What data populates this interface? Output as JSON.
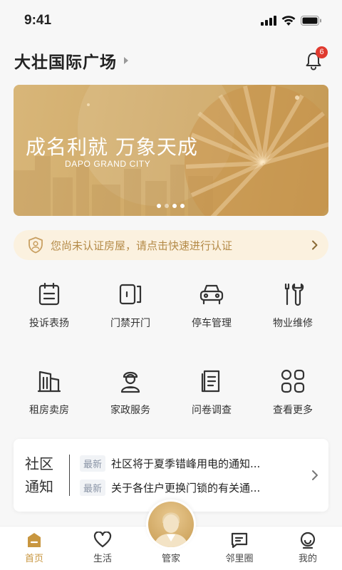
{
  "status": {
    "time": "9:41"
  },
  "header": {
    "community_name": "大壮国际广场",
    "notification_count": "6"
  },
  "banner": {
    "title": "成名利就 万象天成",
    "subtitle": "DAPO GRAND CITY",
    "slide_count": 4,
    "active_slide": 2
  },
  "notice": {
    "text": "您尚未认证房屋，请点击快速进行认证"
  },
  "services": [
    {
      "label": "投诉表扬",
      "icon": "clipboard-icon"
    },
    {
      "label": "门禁开门",
      "icon": "door-icon"
    },
    {
      "label": "停车管理",
      "icon": "car-icon"
    },
    {
      "label": "物业维修",
      "icon": "wrench-icon"
    },
    {
      "label": "租房卖房",
      "icon": "building-icon"
    },
    {
      "label": "家政服务",
      "icon": "housekeeper-icon"
    },
    {
      "label": "问卷调查",
      "icon": "questionnaire-icon"
    },
    {
      "label": "查看更多",
      "icon": "grid-more-icon"
    }
  ],
  "news": {
    "title_line1": "社区",
    "title_line2": "通知",
    "items": [
      {
        "tag": "最新",
        "text": "社区将于夏季错峰用电的通知..."
      },
      {
        "tag": "最新",
        "text": "关于各住户更换门锁的有关通..."
      }
    ]
  },
  "tabbar": {
    "active_index": 0,
    "accent": "#c8963f",
    "items": [
      {
        "label": "首页",
        "icon": "home-icon"
      },
      {
        "label": "生活",
        "icon": "heart-icon"
      },
      {
        "label": "管家",
        "icon": "butler-avatar-icon"
      },
      {
        "label": "邻里圈",
        "icon": "chat-icon"
      },
      {
        "label": "我的",
        "icon": "profile-icon"
      }
    ]
  }
}
